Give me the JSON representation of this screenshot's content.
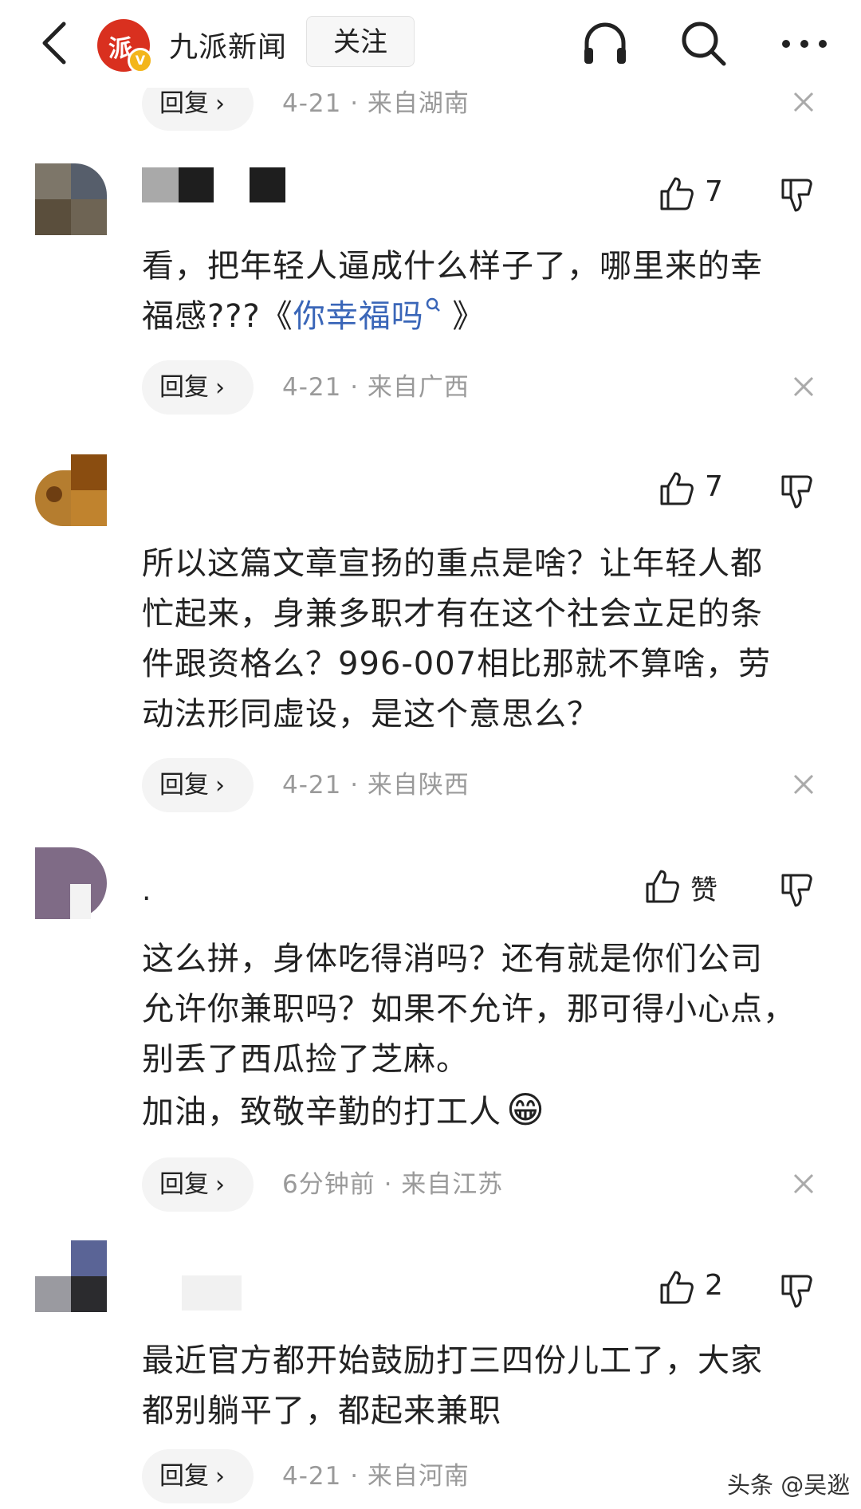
{
  "header": {
    "account_name": "九派新闻",
    "follow_label": "关注",
    "avatar_glyph": "派",
    "verified_badge": "V"
  },
  "icons": {
    "back": "back-arrow-icon",
    "headphones": "headphones-icon",
    "search": "search-icon",
    "more": "more-dots-icon",
    "like": "thumbs-up-icon",
    "dislike": "thumbs-down-icon",
    "close": "close-x-icon"
  },
  "colors": {
    "link": "#3a66b8",
    "meta": "#9a9a9a",
    "brand_red": "#d9301f"
  },
  "top_partial": {
    "reply_label": "回复",
    "meta": "4-21 · 来自湖南"
  },
  "comments": [
    {
      "username": "",
      "likes": "7",
      "text_line1": "看，把年轻人逼成什么样子了，哪里来的幸",
      "text_line2_prefix": "福感???《",
      "link_text": "你幸福吗",
      "text_line2_suffix": " 》",
      "reply_label": "回复",
      "meta": "4-21 · 来自广西"
    },
    {
      "username": "",
      "likes": "7",
      "text_lines": [
        "所以这篇文章宣扬的重点是啥？让年轻人都",
        "忙起来，身兼多职才有在这个社会立足的条",
        "件跟资格么？996-007相比那就不算啥，劳",
        "动法形同虚设，是这个意思么？"
      ],
      "reply_label": "回复",
      "meta": "4-21 · 来自陕西"
    },
    {
      "username": ".",
      "likes": "赞",
      "text_lines": [
        "这么拼，身体吃得消吗？还有就是你们公司",
        "允许你兼职吗？如果不允许，那可得小心点，",
        "别丢了西瓜捡了芝麻。",
        "加油，致敬辛勤的打工人"
      ],
      "emoji": "😁",
      "reply_label": "回复",
      "meta": "6分钟前 · 来自江苏"
    },
    {
      "username": "",
      "likes": "2",
      "text_lines": [
        "最近官方都开始鼓励打三四份儿工了，大家",
        "都别躺平了，都起来兼职"
      ],
      "reply_label": "回复",
      "meta": "4-21 · 来自河南"
    }
  ],
  "watermark": "头条 @吴逖"
}
